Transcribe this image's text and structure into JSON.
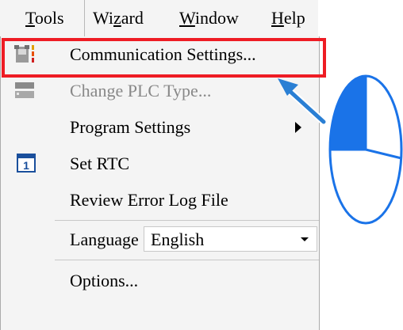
{
  "menubar": {
    "items": [
      {
        "label": "Tools",
        "underline": "T",
        "rest": "ools"
      },
      {
        "label": "Wizard",
        "pre": "Wi",
        "underline": "z",
        "post": "ard"
      },
      {
        "label": "Window",
        "underline": "W",
        "rest": "indow"
      },
      {
        "label": "Help",
        "underline": "H",
        "rest": "elp"
      }
    ]
  },
  "tools_menu": {
    "items": [
      {
        "label": "Communication Settings...",
        "icon": "communication-settings-icon",
        "enabled": true
      },
      {
        "label": "Change PLC Type...",
        "icon": "plc-type-icon",
        "enabled": false
      },
      {
        "label": "Program Settings",
        "icon": "",
        "enabled": true,
        "submenu": true
      },
      {
        "label": "Set RTC",
        "icon": "calendar-icon",
        "icon_text": "1",
        "enabled": true
      },
      {
        "label": "Review Error Log File",
        "icon": "",
        "enabled": true
      },
      {
        "label": "Language",
        "icon": "",
        "enabled": true,
        "select_value": "English"
      },
      {
        "label": "Options...",
        "icon": "",
        "enabled": true
      }
    ]
  },
  "colors": {
    "highlight_border": "#ee1c24",
    "callout_blue": "#1a73e8",
    "arrow_blue": "#2a7fd4"
  }
}
